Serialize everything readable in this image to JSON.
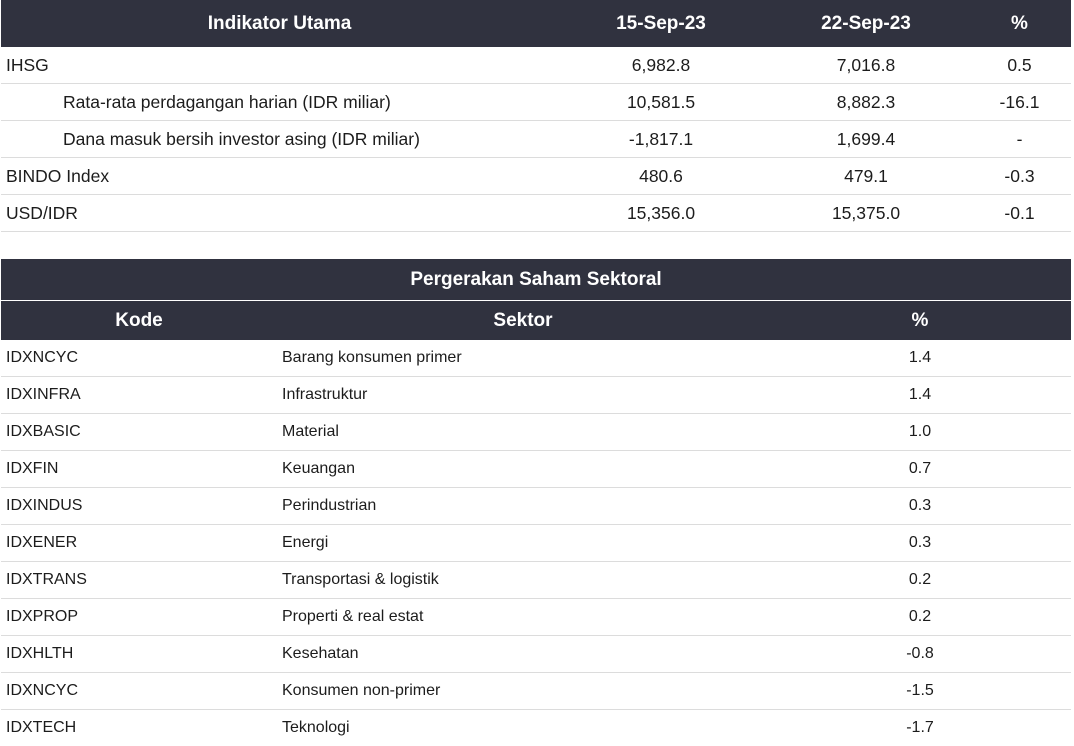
{
  "indicators": {
    "headers": [
      "Indikator Utama",
      "15-Sep-23",
      "22-Sep-23",
      "%"
    ],
    "rows": [
      {
        "label": "IHSG",
        "v1": "6,982.8",
        "v2": "7,016.8",
        "pct": "0.5"
      },
      {
        "label": "Rata-rata perdagangan harian (IDR miliar)",
        "v1": "10,581.5",
        "v2": "8,882.3",
        "pct": "-16.1"
      },
      {
        "label": "Dana masuk bersih investor asing (IDR miliar)",
        "v1": "-1,817.1",
        "v2": "1,699.4",
        "pct": "-"
      },
      {
        "label": "BINDO Index",
        "v1": "480.6",
        "v2": "479.1",
        "pct": "-0.3"
      },
      {
        "label": "USD/IDR",
        "v1": "15,356.0",
        "v2": "15,375.0",
        "pct": "-0.1"
      }
    ]
  },
  "sectors": {
    "title": "Pergerakan Saham Sektoral",
    "headers": [
      "Kode",
      "Sektor",
      "%"
    ],
    "rows": [
      {
        "code": "IDXNCYC",
        "sector": "Barang konsumen primer",
        "pct": "1.4"
      },
      {
        "code": "IDXINFRA",
        "sector": "Infrastruktur",
        "pct": "1.4"
      },
      {
        "code": "IDXBASIC",
        "sector": "Material",
        "pct": "1.0"
      },
      {
        "code": "IDXFIN",
        "sector": "Keuangan",
        "pct": "0.7"
      },
      {
        "code": "IDXINDUS",
        "sector": "Perindustrian",
        "pct": "0.3"
      },
      {
        "code": "IDXENER",
        "sector": "Energi",
        "pct": "0.3"
      },
      {
        "code": "IDXTRANS",
        "sector": "Transportasi & logistik",
        "pct": "0.2"
      },
      {
        "code": "IDXPROP",
        "sector": "Properti & real estat",
        "pct": "0.2"
      },
      {
        "code": "IDXHLTH",
        "sector": "Kesehatan",
        "pct": "-0.8"
      },
      {
        "code": "IDXNCYC",
        "sector": "Konsumen non-primer",
        "pct": "-1.5"
      },
      {
        "code": "IDXTECH",
        "sector": "Teknologi",
        "pct": "-1.7"
      }
    ]
  }
}
